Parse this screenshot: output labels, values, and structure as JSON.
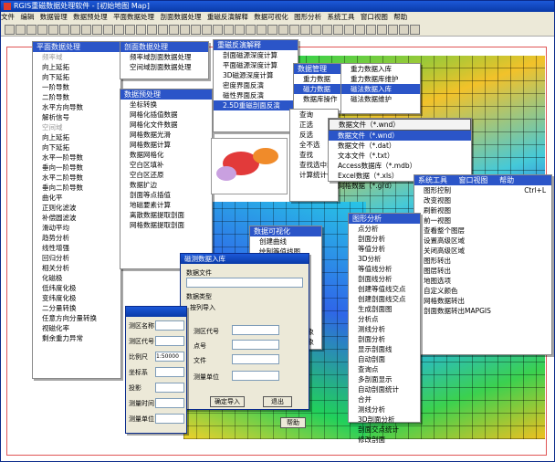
{
  "window": {
    "title": "RGIS重磁数据处理软件 - [初始地图 Map]"
  },
  "menubar": [
    "文件",
    "编辑",
    "数据管理",
    "数据预处理",
    "平面数据处理",
    "剖面数据处理",
    "重磁反演解释",
    "数据可视化",
    "图形分析",
    "系统工具",
    "窗口视图",
    "帮助"
  ],
  "menu_plane": {
    "title": "平面数据处理",
    "items": [
      "频率域",
      "向上延拓",
      "向下延拓",
      "一阶导数",
      "二阶导数",
      "水平方向导数",
      "解析信号",
      "空间域",
      "向上延拓",
      "向下延拓",
      "水平一阶导数",
      "垂向一阶导数",
      "水平二阶导数",
      "垂向二阶导数",
      "曲化平",
      "正则化滤波",
      "补偿圆滤波",
      "滑动平均",
      "趋势分析",
      "线性增强",
      "回归分析",
      "相关分析",
      "化磁极",
      "低纬度化极",
      "变纬度化极",
      "二分量转换",
      "任意方向分量转换",
      "视磁化率",
      "剩余重力异常"
    ],
    "gray": [
      0,
      7
    ]
  },
  "menu_profile": {
    "title": "剖面数据处理",
    "items": [
      "频率域剖面数据处理",
      "空间域剖面数据处理"
    ]
  },
  "menu_preprocess": {
    "title": "数据预处理",
    "items": [
      "坐标转换",
      "网格化插值数据",
      "网格化文件数据",
      "网格数据光滑",
      "网格数据计算",
      "数据网格化",
      "空白区填补",
      "空白区还原",
      "数据扩边",
      "剖面等点插值",
      "地磁要素计算",
      "离散数据提取剖面",
      "网格数据提取剖面"
    ]
  },
  "menu_inversion": {
    "title": "重磁反演解释",
    "items": [
      "剖面磁源深度计算",
      "平面磁源深度计算",
      "3D磁源深度计算",
      "密度界面反演",
      "磁性界面反演",
      "2.5D重磁剖面反演"
    ],
    "selected": 5
  },
  "menu_datamgr": {
    "title": "数据管理",
    "items": [
      "重力数据",
      "磁力数据",
      "数据库操作",
      "数据管理"
    ]
  },
  "menu_import": {
    "items": [
      "重力数据入库",
      "重力数据库维护",
      "磁法数据入库",
      "磁法数据维护"
    ],
    "selected": 2
  },
  "menu_fileformat": {
    "items": [
      "数据文件（*.wnd）",
      "数据文件（*.dat）",
      "文本文件（*.txt）",
      "Access数据库（*.mdb）",
      "Excel数据（*.xls）",
      "网格数据（*.grd）"
    ],
    "selected": 0,
    "header": "数据文件（*.wnd）"
  },
  "menu_query": {
    "items": [
      "查询",
      "正选",
      "反选",
      "全不选",
      "查找",
      "查找选中部分",
      "计算统计值"
    ]
  },
  "menu_system": {
    "title": "系统工具",
    "header_window": "窗口视图",
    "header_help": "帮助",
    "items": [
      "图形控制",
      "改变视图",
      "刷新视图",
      "前一视图",
      "查看整个图层",
      "设置高级区域",
      "关闭高级区域",
      "图形转出",
      "图层转出",
      "地图选项",
      "自定义颜色",
      "网格数据转出",
      "剖面数据转出MAPGIS"
    ],
    "shortcut": "Ctrl+L"
  },
  "menu_analysis": {
    "title": "图形分析",
    "items": [
      "点分析",
      "剖面分析",
      "等值分析",
      "3D分析",
      "等值线分析",
      "剖面线分析",
      "创建等值线交点",
      "创建剖面线交点",
      "生成剖面图",
      "分析点",
      "测线分析",
      "剖面分析",
      "显示剖面线",
      "自动剖面",
      "查询点",
      "多剖面显示",
      "自动剖面统计",
      "合并",
      "测线分析",
      "3D剖面分析",
      "剖面交点统计",
      "修改剖面"
    ]
  },
  "menu_visual": {
    "title": "数据可视化",
    "items": [
      "创建曲线",
      "绘制等值线图",
      "创建3D曲面图",
      "创建彩色图",
      "创建专题地图",
      "修改专题地图",
      "绘制图框",
      "创建图例",
      "清除自定义标注",
      "保存曲线图层对象",
      "清除曲线图层对象"
    ]
  },
  "dialog_import": {
    "title": "磁测数据入库",
    "field_labels": [
      "数据文件",
      "数据类型",
      "测区代号",
      "点号",
      "文件",
      "测量单位"
    ],
    "radio": "按列导入",
    "buttons": [
      "确定导入",
      "退出",
      "帮助"
    ]
  },
  "dialog_small": {
    "labels": [
      "测区名称",
      "测区代号",
      "比例尺",
      "坐标系",
      "投影",
      "测量时间",
      "测量单位"
    ],
    "values": [
      "",
      "",
      "1:50000",
      "",
      "",
      "",
      ""
    ]
  },
  "colors": {
    "title_bar": "#0a3aa8",
    "menu_highlight": "#2b55c8",
    "frame": "#e05555"
  }
}
